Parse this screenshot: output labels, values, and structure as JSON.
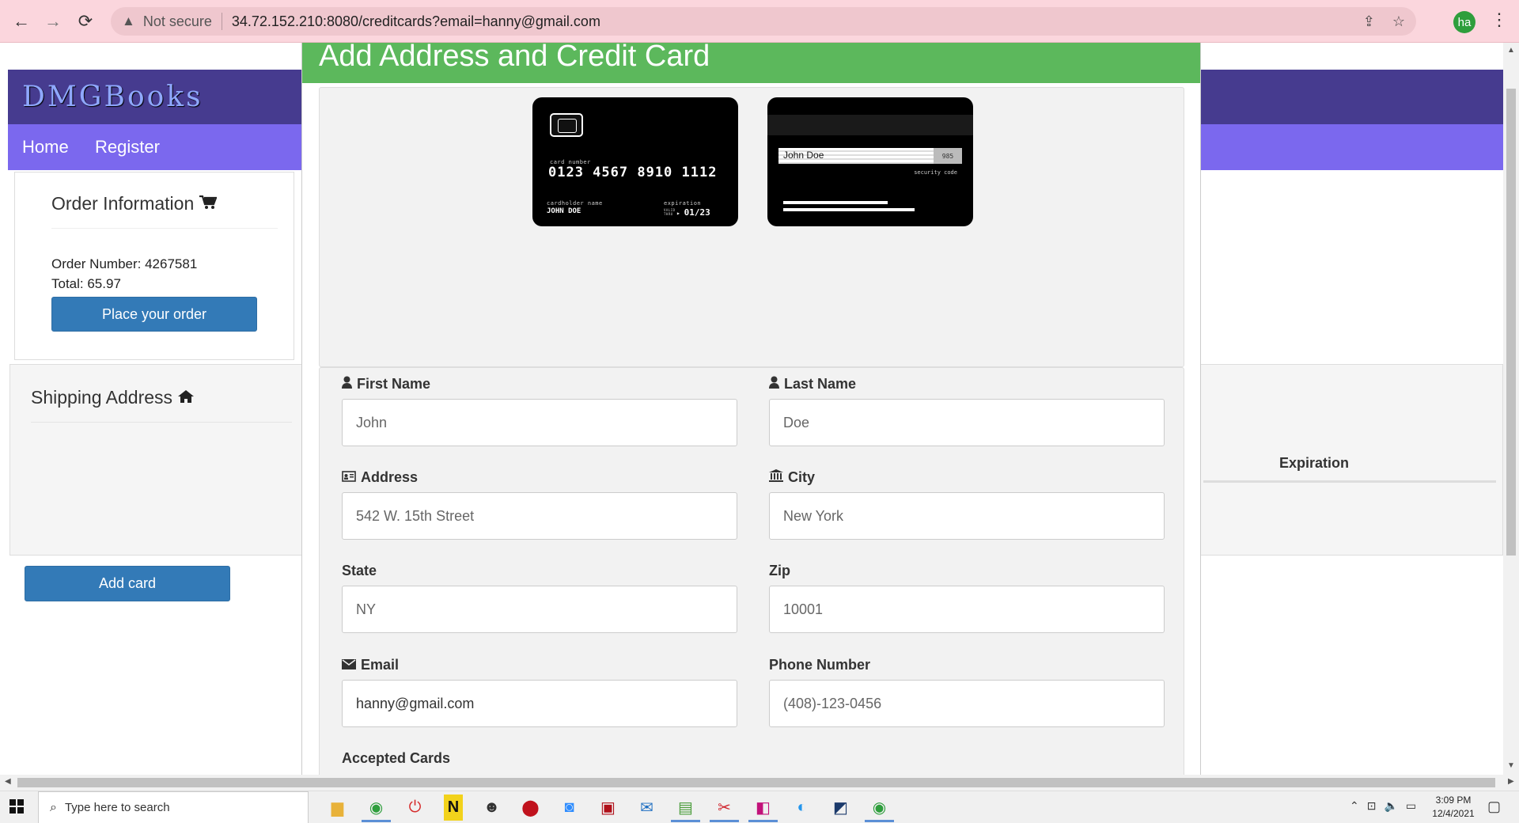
{
  "browser": {
    "security_label": "Not secure",
    "url": "34.72.152.210:8080/creditcards?email=hanny@gmail.com",
    "profile_initials": "ha"
  },
  "site": {
    "brand": "DMGBooks",
    "nav": [
      {
        "label": "Home"
      },
      {
        "label": "Register"
      }
    ]
  },
  "order": {
    "title": "Order Information",
    "number_label": "Order Number: 4267581",
    "total_label": "Total: 65.97",
    "place_order_label": "Place your order"
  },
  "shipping": {
    "title": "Shipping Address",
    "expiration_header": "Expiration"
  },
  "add_card_label": "Add card",
  "modal": {
    "title": "Add Address and Credit Card",
    "card_front": {
      "number_label": "card number",
      "number": "0123 4567 8910 1112",
      "holder_label": "cardholder name",
      "holder": "JOHN DOE",
      "expiration_label": "expiration",
      "valid_thru": "VALID THRU",
      "expiration": "01/23"
    },
    "card_back": {
      "signature": "John Doe",
      "cvv": "985",
      "security_label": "security code"
    },
    "form": {
      "first_name": {
        "label": "First Name",
        "placeholder": "John"
      },
      "last_name": {
        "label": "Last Name",
        "placeholder": "Doe"
      },
      "address": {
        "label": "Address",
        "placeholder": "542 W. 15th Street"
      },
      "city": {
        "label": "City",
        "placeholder": "New York"
      },
      "state": {
        "label": "State",
        "placeholder": "NY"
      },
      "zip": {
        "label": "Zip",
        "placeholder": "10001"
      },
      "email": {
        "label": "Email",
        "value": "hanny@gmail.com"
      },
      "phone": {
        "label": "Phone Number",
        "placeholder": "(408)-123-0456"
      },
      "accepted_cards_label": "Accepted Cards"
    }
  },
  "taskbar": {
    "search_placeholder": "Type here to search",
    "time": "3:09 PM",
    "date": "12/4/2021"
  },
  "colors": {
    "header_green": "#5cb85c",
    "brand_purple": "#463b8f",
    "nav_purple": "#7b68ee",
    "button_blue": "#337ab7"
  }
}
